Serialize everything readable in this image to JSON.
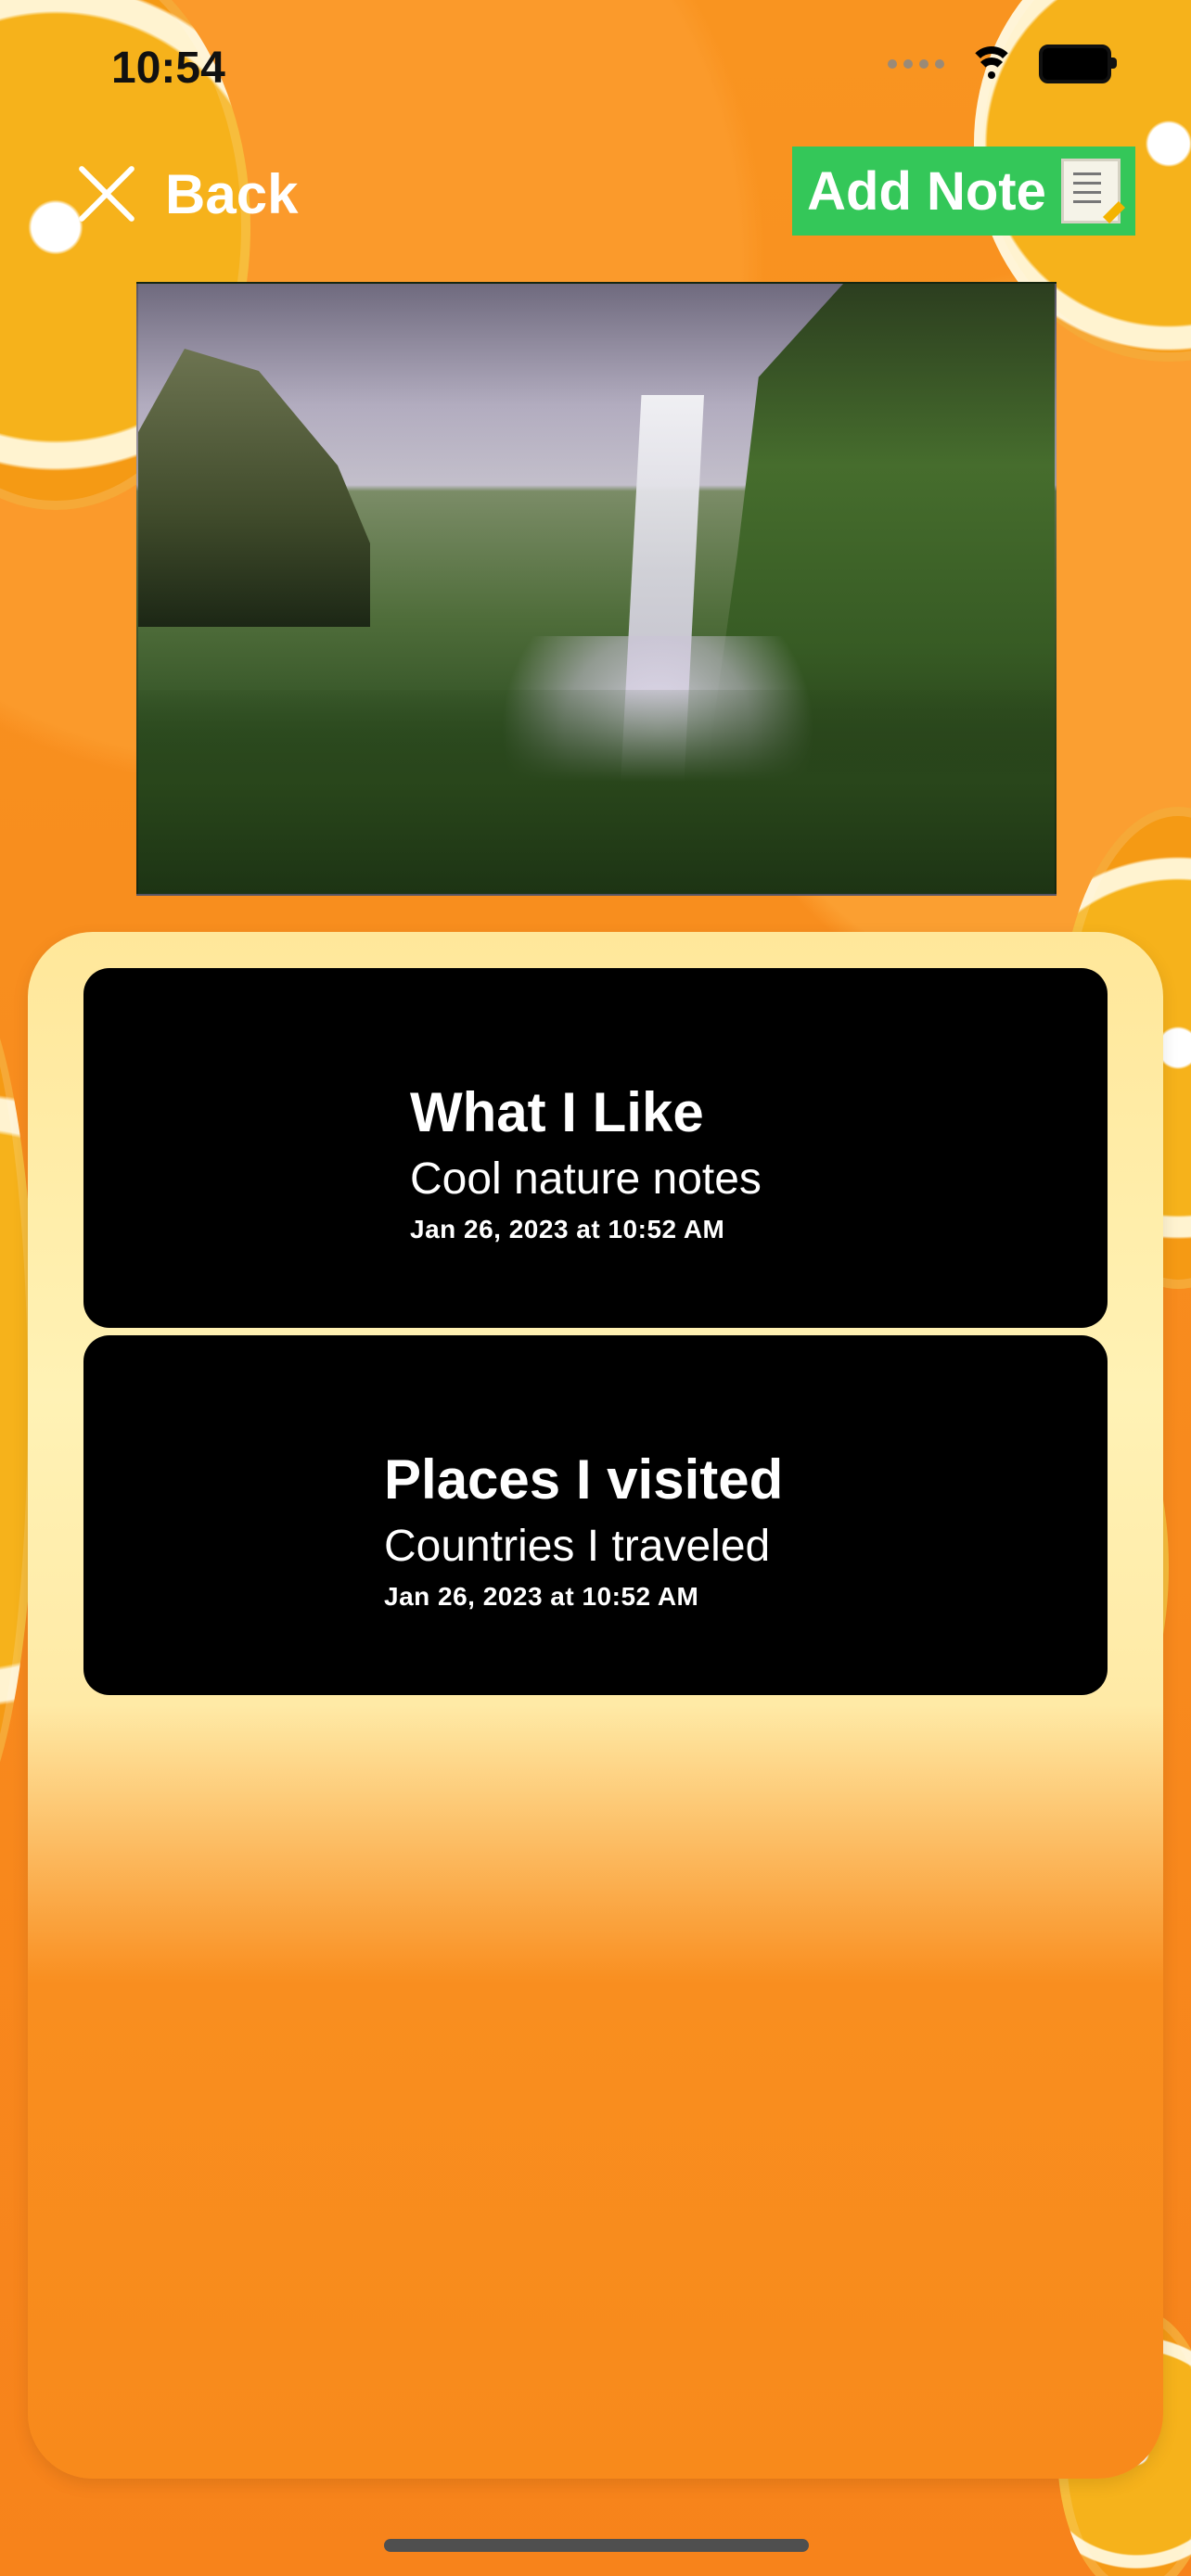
{
  "status_bar": {
    "time": "10:54"
  },
  "navigation": {
    "back_label": "Back",
    "add_note_label": "Add Note"
  },
  "notes": [
    {
      "title": "What I Like",
      "subtitle": "Cool nature notes",
      "date": "Jan 26, 2023 at 10:52 AM"
    },
    {
      "title": "Places I visited",
      "subtitle": "Countries I traveled",
      "date": "Jan 26, 2023 at 10:52 AM"
    }
  ],
  "colors": {
    "accent_green": "#34C759",
    "background_orange": "#F98D1C",
    "card_black": "#000000",
    "panel_yellow": "#FFE79A"
  },
  "icons": {
    "close": "close-icon",
    "note": "memo-icon",
    "wifi": "wifi-icon",
    "battery": "battery-icon"
  }
}
